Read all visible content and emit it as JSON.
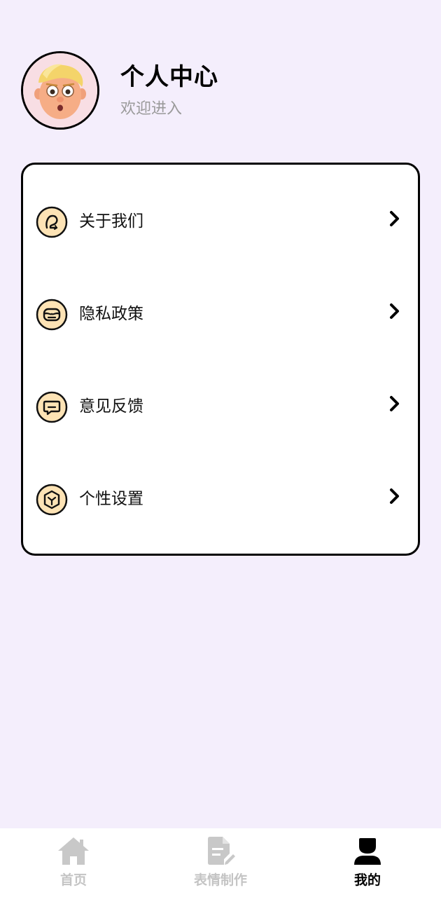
{
  "header": {
    "title": "个人中心",
    "subtitle": "欢迎进入"
  },
  "menu": {
    "items": [
      {
        "label": "关于我们",
        "icon": "about-icon"
      },
      {
        "label": "隐私政策",
        "icon": "privacy-icon"
      },
      {
        "label": "意见反馈",
        "icon": "feedback-icon"
      },
      {
        "label": "个性设置",
        "icon": "settings-icon"
      }
    ]
  },
  "tabbar": {
    "tabs": [
      {
        "label": "首页",
        "icon": "home-icon",
        "active": false
      },
      {
        "label": "表情制作",
        "icon": "document-edit-icon",
        "active": false
      },
      {
        "label": "我的",
        "icon": "user-icon",
        "active": true
      }
    ]
  },
  "colors": {
    "background": "#f4eefc",
    "icon_fill": "#fde3b5",
    "inactive": "#c4c4c4",
    "active": "#000000"
  }
}
